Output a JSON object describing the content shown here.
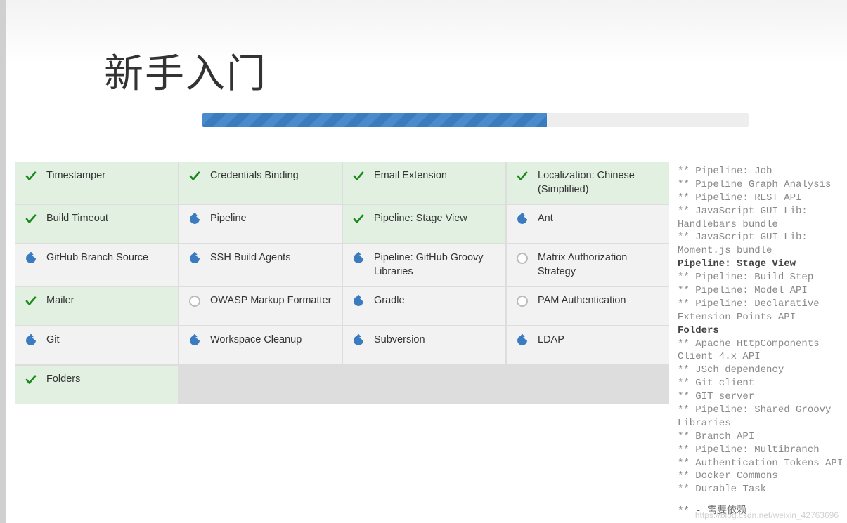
{
  "title": "新手入门",
  "progress_percent": 63,
  "plugins": [
    {
      "name": "Timestamper",
      "state": "done"
    },
    {
      "name": "Credentials Binding",
      "state": "done"
    },
    {
      "name": "Email Extension",
      "state": "done"
    },
    {
      "name": "Localization: Chinese (Simplified)",
      "state": "done"
    },
    {
      "name": "Build Timeout",
      "state": "done"
    },
    {
      "name": "Pipeline",
      "state": "running"
    },
    {
      "name": "Pipeline: Stage View",
      "state": "done"
    },
    {
      "name": "Ant",
      "state": "running"
    },
    {
      "name": "GitHub Branch Source",
      "state": "running"
    },
    {
      "name": "SSH Build Agents",
      "state": "running"
    },
    {
      "name": "Pipeline: GitHub Groovy Libraries",
      "state": "running"
    },
    {
      "name": "Matrix Authorization Strategy",
      "state": "pending"
    },
    {
      "name": "Mailer",
      "state": "done"
    },
    {
      "name": "OWASP Markup Formatter",
      "state": "pending"
    },
    {
      "name": "Gradle",
      "state": "running"
    },
    {
      "name": "PAM Authentication",
      "state": "pending"
    },
    {
      "name": "Git",
      "state": "running"
    },
    {
      "name": "Workspace Cleanup",
      "state": "running"
    },
    {
      "name": "Subversion",
      "state": "running"
    },
    {
      "name": "LDAP",
      "state": "running"
    },
    {
      "name": "Folders",
      "state": "done"
    }
  ],
  "log": [
    {
      "text": "** Pipeline: Job",
      "bold": false
    },
    {
      "text": "** Pipeline Graph Analysis",
      "bold": false
    },
    {
      "text": "** Pipeline: REST API",
      "bold": false
    },
    {
      "text": "** JavaScript GUI Lib: Handlebars bundle",
      "bold": false
    },
    {
      "text": "** JavaScript GUI Lib: Moment.js bundle",
      "bold": false
    },
    {
      "text": "Pipeline: Stage View",
      "bold": true
    },
    {
      "text": "** Pipeline: Build Step",
      "bold": false
    },
    {
      "text": "** Pipeline: Model API",
      "bold": false
    },
    {
      "text": "** Pipeline: Declarative Extension Points API",
      "bold": false
    },
    {
      "text": "Folders",
      "bold": true
    },
    {
      "text": "** Apache HttpComponents Client 4.x API",
      "bold": false
    },
    {
      "text": "** JSch dependency",
      "bold": false
    },
    {
      "text": "** Git client",
      "bold": false
    },
    {
      "text": "** GIT server",
      "bold": false
    },
    {
      "text": "** Pipeline: Shared Groovy Libraries",
      "bold": false
    },
    {
      "text": "** Branch API",
      "bold": false
    },
    {
      "text": "** Pipeline: Multibranch",
      "bold": false
    },
    {
      "text": "** Authentication Tokens API",
      "bold": false
    },
    {
      "text": "** Docker Commons",
      "bold": false
    },
    {
      "text": "** Durable Task",
      "bold": false
    }
  ],
  "log_footer": "** - 需要依赖",
  "watermark": "https://blog.csdn.net/weixin_42763696"
}
